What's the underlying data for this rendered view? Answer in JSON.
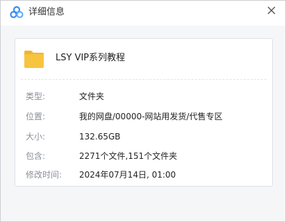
{
  "window": {
    "title": "详细信息",
    "app_icon": "cloud-drive-logo-icon",
    "close_icon": "close-icon"
  },
  "file": {
    "icon": "folder-icon",
    "name": "LSY VIP系列教程"
  },
  "details": [
    {
      "label": "类型:",
      "value": "文件夹"
    },
    {
      "label": "位置:",
      "value": "我的网盘/00000-网站用发货/代售专区"
    },
    {
      "label": "大小:",
      "value": "132.65GB"
    },
    {
      "label": "包含:",
      "value": "2271个文件,151个文件夹"
    },
    {
      "label": "修改时间:",
      "value": "2024年07月14日, 01:00"
    }
  ],
  "colors": {
    "folder": "#f7c440",
    "folder_tab": "#f2b430",
    "logo_primary": "#3c8af2",
    "logo_accent": "#5fb0ff"
  }
}
